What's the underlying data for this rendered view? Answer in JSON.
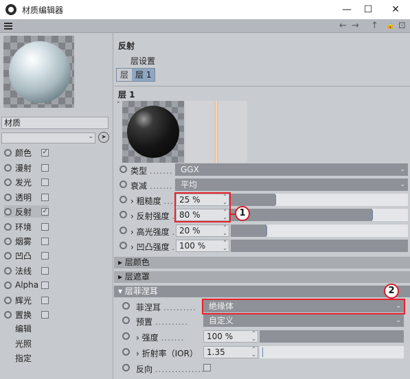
{
  "window": {
    "title": "材质编辑器",
    "minimize_glyph": "—",
    "maximize_glyph": "☐",
    "close_glyph": "✕"
  },
  "toolbar": {
    "back_glyph": "←",
    "forward_glyph": "→",
    "up_glyph": "↑",
    "lock_glyph": "🔒",
    "new_glyph": "⊡"
  },
  "left_panel": {
    "material_name": "材质",
    "channels": [
      {
        "label": "颜色",
        "checked": true,
        "check_glyph": "✓"
      },
      {
        "label": "漫射",
        "checked": false,
        "check_glyph": ""
      },
      {
        "label": "发光",
        "checked": false,
        "check_glyph": ""
      },
      {
        "label": "透明",
        "checked": false,
        "check_glyph": ""
      },
      {
        "label": "反射",
        "checked": true,
        "check_glyph": "✓"
      },
      {
        "label": "环境",
        "checked": false,
        "check_glyph": ""
      },
      {
        "label": "烟雾",
        "checked": false,
        "check_glyph": ""
      },
      {
        "label": "凹凸",
        "checked": false,
        "check_glyph": ""
      },
      {
        "label": "法线",
        "checked": false,
        "check_glyph": ""
      },
      {
        "label": "Alpha",
        "checked": false,
        "check_glyph": ""
      },
      {
        "label": "辉光",
        "checked": false,
        "check_glyph": ""
      },
      {
        "label": "置换",
        "checked": false,
        "check_glyph": ""
      }
    ],
    "extra": [
      "编辑",
      "光照",
      "指定"
    ]
  },
  "reflectance": {
    "section_title": "反射",
    "layer_settings": "层设置",
    "tabs": [
      "层",
      "层 1"
    ],
    "layer_title": "层 1",
    "type_label": "类型",
    "type_value": "GGX",
    "attenuation_label": "衰减",
    "attenuation_value": "平均",
    "roughness_label": "粗糙度",
    "roughness_value": "25 %",
    "roughness_fraction": 0.25,
    "strength_label": "反射强度",
    "strength_value": "80 %",
    "strength_fraction": 0.8,
    "specular_label": "高光强度",
    "specular_value": "20 %",
    "specular_fraction": 0.2,
    "bump_label": "凹凸强度",
    "bump_value": "100 %",
    "bump_fraction": 1.0,
    "groups": {
      "color": "层颜色",
      "mask": "层遮罩",
      "fresnel": "层菲涅耳"
    },
    "fresnel": {
      "label": "菲涅耳",
      "value": "绝缘体",
      "preset_label": "预置",
      "preset_value": "自定义",
      "strength_label": "强度",
      "strength_value": "100 %",
      "strength_fraction": 1.0,
      "ior_label": "折射率（IOR）",
      "ior_value": "1.35",
      "invert_label": "反向"
    }
  },
  "annotations": [
    "1",
    "2"
  ]
}
